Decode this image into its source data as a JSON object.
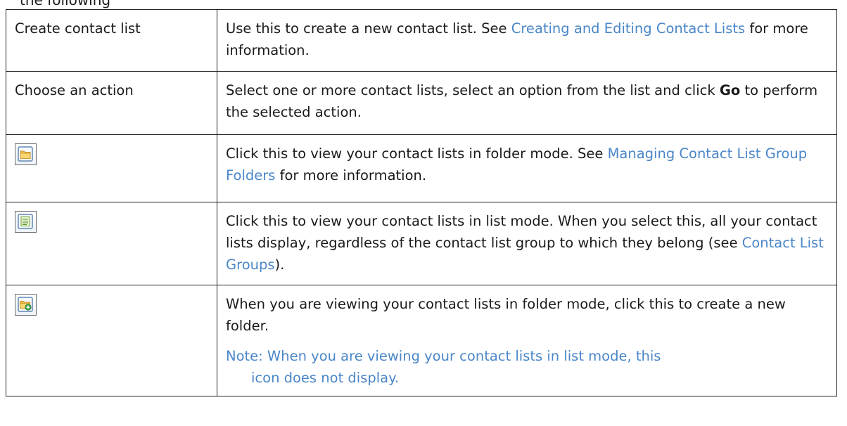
{
  "top_fragment": "the following",
  "rows": [
    {
      "label": "Create contact list",
      "desc_a": "Use this to create a new contact list. See ",
      "link": "Creating and Editing Contact Lists",
      "desc_b": " for more information."
    },
    {
      "label": "Choose an action",
      "desc_a": "Select one or more contact lists, select an option from the list and click ",
      "bold": "Go",
      "desc_b": " to perform the selected action."
    },
    {
      "icon": "folder-view-icon",
      "desc_a": "Click this to view your contact lists in folder mode. See ",
      "link": "Managing Contact List Group Folders",
      "desc_b": " for more information."
    },
    {
      "icon": "list-view-icon",
      "desc_a": "Click this to view your contact lists in list mode. When you select this, all your contact lists display, regardless of the contact list group to which they belong (see ",
      "link": "Contact List Groups",
      "desc_b": ")."
    },
    {
      "icon": "new-folder-icon",
      "desc_a": "When you are viewing your contact lists in folder mode, click this to create a new folder.",
      "note_line1": "Note: When you are viewing your contact lists in list mode, this",
      "note_line2": "icon does not display."
    }
  ]
}
